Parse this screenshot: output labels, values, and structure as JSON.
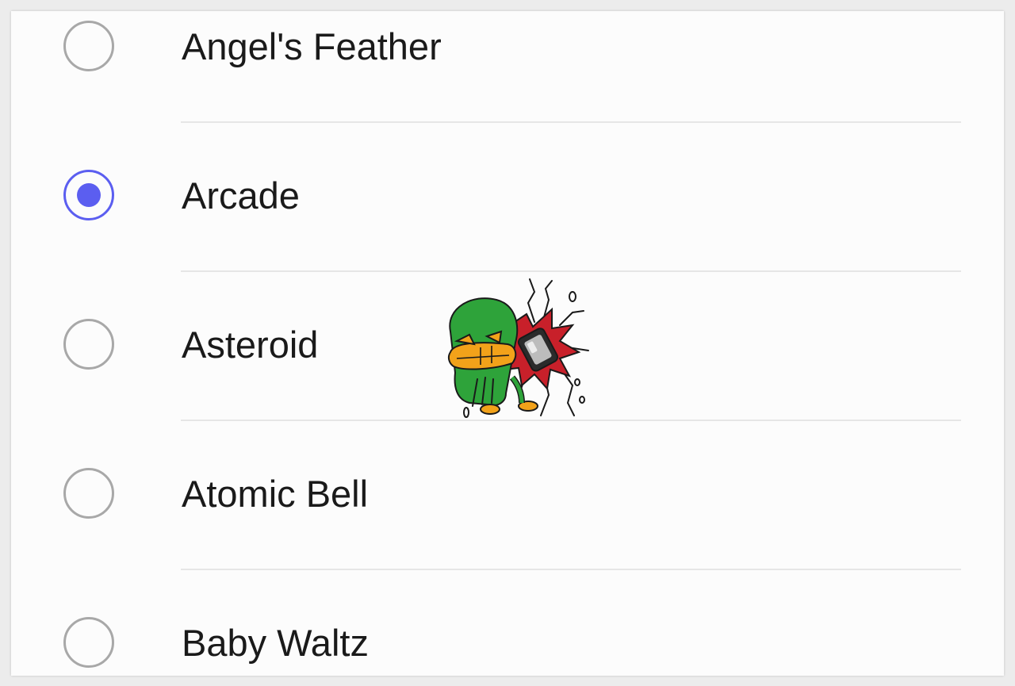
{
  "ringtone_list": {
    "items": [
      {
        "label": "Angel's Feather",
        "selected": false
      },
      {
        "label": "Arcade",
        "selected": true
      },
      {
        "label": "Asteroid",
        "selected": false
      },
      {
        "label": "Atomic Bell",
        "selected": false
      },
      {
        "label": "Baby Waltz",
        "selected": false
      }
    ]
  },
  "colors": {
    "accent": "#5b5ef0",
    "radio_unchecked": "#a8a8a8",
    "divider": "#e6e6e6",
    "text": "#1a1a1a"
  },
  "overlay": {
    "icon": "smashing-phone-sticker-icon"
  }
}
